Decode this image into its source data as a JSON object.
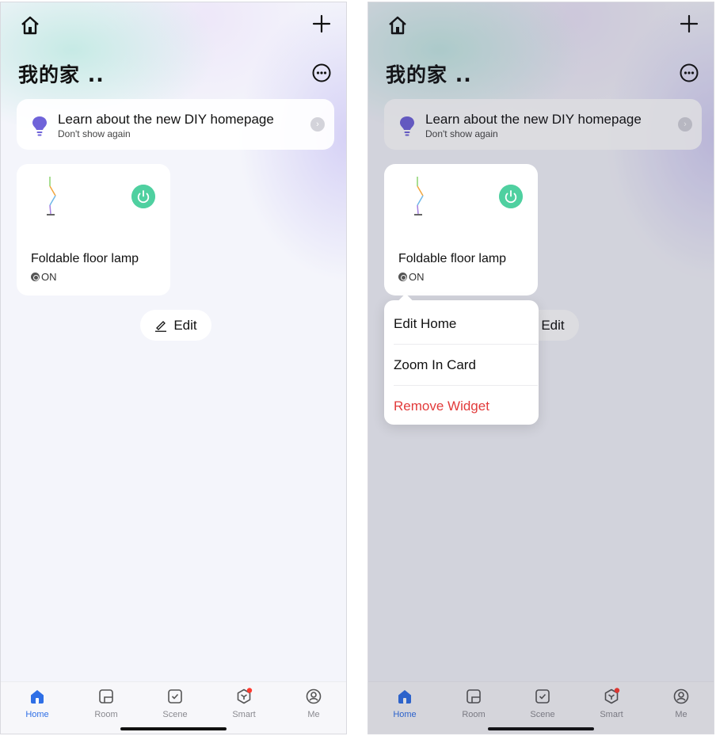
{
  "home": {
    "title": "我的家 ..",
    "tip": {
      "title": "Learn about the new DIY homepage",
      "subtitle": "Don't show again"
    },
    "device": {
      "name": "Foldable floor lamp",
      "status": "ON"
    },
    "edit_label": "Edit"
  },
  "context_menu": {
    "items": [
      "Edit Home",
      "Zoom In Card",
      "Remove Widget"
    ]
  },
  "tabs": [
    {
      "label": "Home",
      "icon": "home-icon",
      "active": true
    },
    {
      "label": "Room",
      "icon": "room-icon",
      "active": false
    },
    {
      "label": "Scene",
      "icon": "scene-icon",
      "active": false
    },
    {
      "label": "Smart",
      "icon": "smart-icon",
      "active": false,
      "badge": true
    },
    {
      "label": "Me",
      "icon": "me-icon",
      "active": false
    }
  ],
  "colors": {
    "accent": "#2f6fe6",
    "power_on": "#4fd0a0",
    "danger": "#e23b3b",
    "badge": "#ff3b30"
  }
}
